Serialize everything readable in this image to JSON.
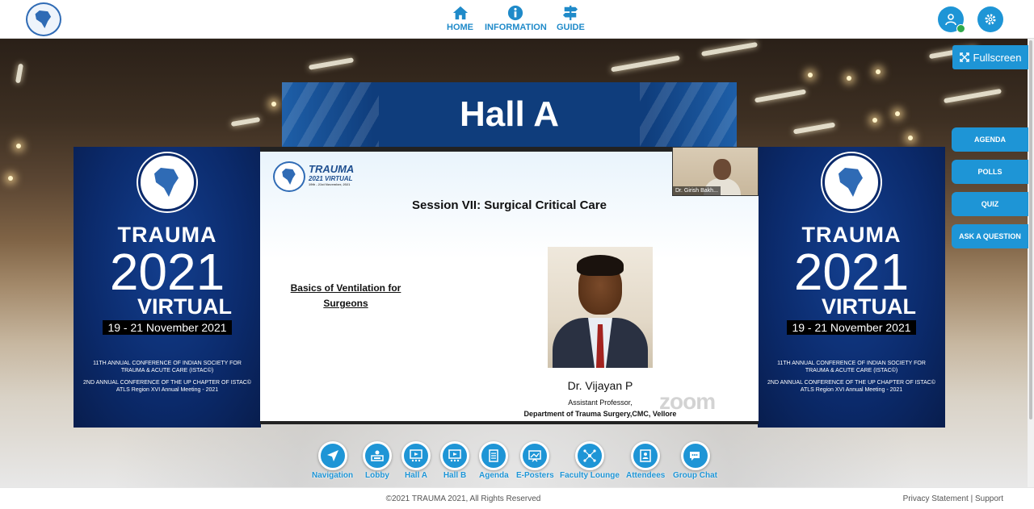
{
  "header": {
    "nav": [
      {
        "label": "HOME",
        "icon": "home-icon"
      },
      {
        "label": "INFORMATION",
        "icon": "info-icon"
      },
      {
        "label": "GUIDE",
        "icon": "signpost-icon"
      }
    ]
  },
  "side": {
    "fullscreen": "Fullscreen",
    "buttons": [
      "AGENDA",
      "POLLS",
      "QUIZ",
      "ASK A QUESTION"
    ]
  },
  "hall": {
    "title": "Hall A"
  },
  "banner": {
    "t1": "TRAUMA",
    "t2": "2021",
    "t3": "VIRTUAL",
    "dates": "19 - 21 November 2021",
    "line1": "11TH ANNUAL CONFERENCE OF INDIAN SOCIETY FOR TRAUMA & ACUTE CARE (ISTAC©)",
    "line2": "2ND ANNUAL CONFERENCE OF THE UP CHAPTER OF ISTAC© ATLS Region XVI Annual Meeting - 2021"
  },
  "slide": {
    "brand1": "TRAUMA",
    "brand2": "2021 VIRTUAL",
    "brand3": "19th - 21st November, 2021",
    "session": "Session VII: Surgical Critical Care",
    "talk": "Basics of Ventilation for Surgeons",
    "speaker": "Dr. Vijayan P",
    "role": "Assistant Professor,",
    "dept": "Department of Trauma Surgery,CMC, Vellore",
    "watermark": "zoom"
  },
  "video": {
    "participant": "Dr. Girish Bakh..."
  },
  "bottom_nav": [
    {
      "label": "Navigation",
      "icon": "navigation-icon"
    },
    {
      "label": "Lobby",
      "icon": "lobby-icon"
    },
    {
      "label": "Hall A",
      "icon": "hall-a-icon"
    },
    {
      "label": "Hall B",
      "icon": "hall-b-icon"
    },
    {
      "label": "Agenda",
      "icon": "agenda-icon"
    },
    {
      "label": "E-Posters",
      "icon": "eposters-icon"
    },
    {
      "label": "Faculty Lounge",
      "icon": "faculty-lounge-icon"
    },
    {
      "label": "Attendees",
      "icon": "attendees-icon"
    },
    {
      "label": "Group Chat",
      "icon": "group-chat-icon"
    }
  ],
  "footer": {
    "copyright": "©2021 TRAUMA 2021, All Rights Reserved",
    "links": "Privacy Statement | Support"
  },
  "colors": {
    "accent": "#1e95d6",
    "banner": "#0b2a6b",
    "hall_sign": "#0f3d7c"
  }
}
